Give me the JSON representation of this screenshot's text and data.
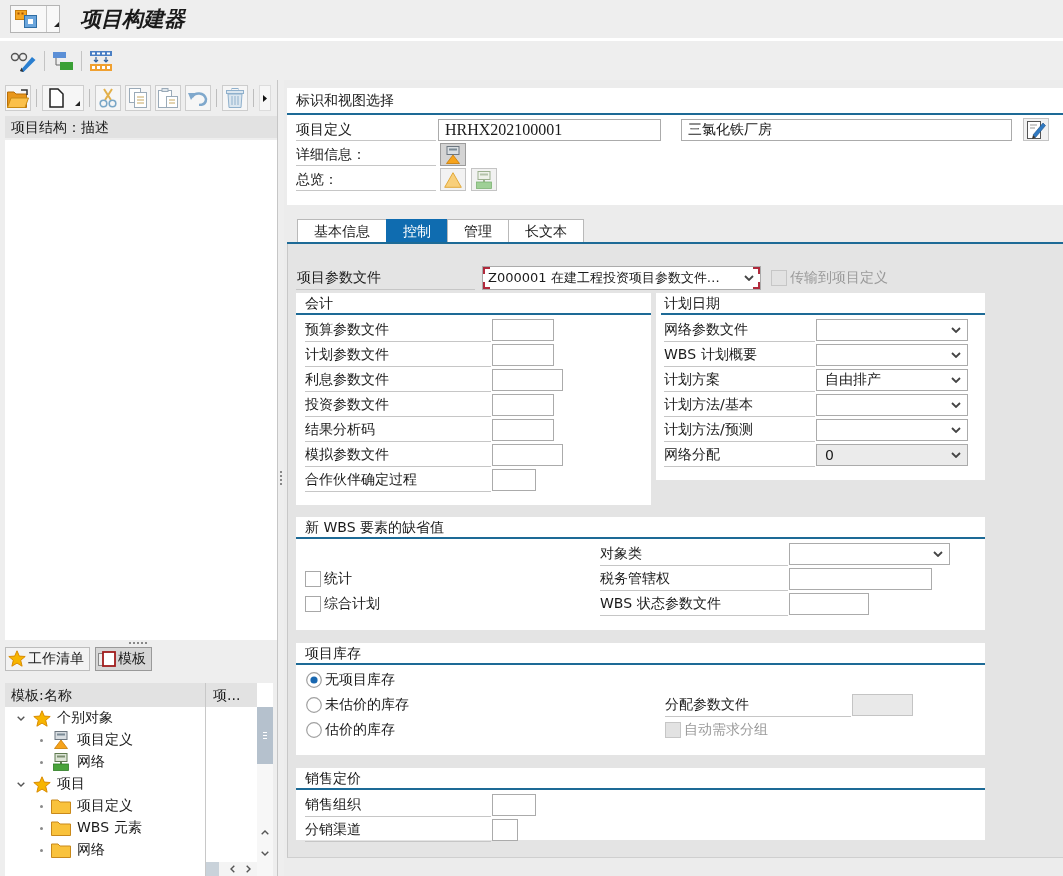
{
  "title_bar": {
    "title": "项目构建器"
  },
  "left_panel": {
    "structure_header": "项目结构：描述",
    "view_buttons": [
      {
        "label": "工作清单",
        "kind": "worklist",
        "selected": false
      },
      {
        "label": "模板",
        "kind": "templates",
        "selected": true
      }
    ],
    "template_tree": {
      "columns": [
        "模板:名称",
        "项..."
      ],
      "items": [
        {
          "label": "个别对象",
          "kind": "group",
          "expanded": true,
          "children": [
            {
              "label": "项目定义",
              "kind": "definition"
            },
            {
              "label": "网络",
              "kind": "network"
            }
          ]
        },
        {
          "label": "项目",
          "kind": "group",
          "expanded": true,
          "children": [
            {
              "label": "项目定义",
              "kind": "folder"
            },
            {
              "label": "WBS 元素",
              "kind": "folder"
            },
            {
              "label": "网络",
              "kind": "folder"
            }
          ]
        }
      ]
    }
  },
  "identification": {
    "title": "标识和视图选择",
    "project_definition": {
      "label": "项目定义",
      "value": "HRHX202100001",
      "description": "三氯化铁厂房"
    },
    "details_label": "详细信息：",
    "overview_label": "总览："
  },
  "tabs": [
    {
      "label": "基本信息",
      "selected": false
    },
    {
      "label": "控制",
      "selected": true
    },
    {
      "label": "管理",
      "selected": false
    },
    {
      "label": "长文本",
      "selected": false
    }
  ],
  "control_tab": {
    "project_profile": {
      "label": "项目参数文件",
      "value": "Z000001 在建工程投资项目参数文件…",
      "focused": true
    },
    "transfer_to_project_definition": {
      "label": "传输到项目定义",
      "checked": false,
      "disabled": true
    },
    "accounting": {
      "title": "会计",
      "fields": [
        {
          "label": "预算参数文件"
        },
        {
          "label": "计划参数文件"
        },
        {
          "label": "利息参数文件"
        },
        {
          "label": "投资参数文件"
        },
        {
          "label": "结果分析码"
        },
        {
          "label": "模拟参数文件"
        },
        {
          "label": "合作伙伴确定过程"
        }
      ]
    },
    "planning_dates": {
      "title": "计划日期",
      "fields": [
        {
          "label": "网络参数文件",
          "read_only": false
        },
        {
          "label": "WBS 计划概要",
          "read_only": false
        },
        {
          "label": "计划方案",
          "value": "自由排产",
          "read_only": false
        },
        {
          "label": "计划方法/基本",
          "read_only": false
        },
        {
          "label": "计划方法/预测",
          "read_only": false
        },
        {
          "label": "网络分配",
          "value": "0",
          "read_only": true
        }
      ]
    },
    "wbs_defaults": {
      "title": "新 WBS 要素的缺省值",
      "checkboxes": [
        {
          "label": "统计",
          "checked": false
        },
        {
          "label": "综合计划",
          "checked": false
        }
      ],
      "fields": [
        {
          "label": "对象类",
          "kind": "dropdown"
        },
        {
          "label": "税务管辖权",
          "kind": "input"
        },
        {
          "label": "WBS 状态参数文件",
          "kind": "input"
        }
      ]
    },
    "project_stock": {
      "title": "项目库存",
      "options": [
        {
          "label": "无项目库存",
          "selected": true
        },
        {
          "label": "未估价的库存",
          "selected": false
        },
        {
          "label": "估价的库存",
          "selected": false
        }
      ],
      "distribution_profile": {
        "label": "分配参数文件",
        "disabled": true
      },
      "auto_requirements_grouping": {
        "label": "自动需求分组",
        "checked": false,
        "disabled": true
      }
    },
    "sales_pricing": {
      "title": "销售定价",
      "fields": [
        {
          "label": "销售组织"
        },
        {
          "label": "分销渠道"
        }
      ]
    }
  }
}
